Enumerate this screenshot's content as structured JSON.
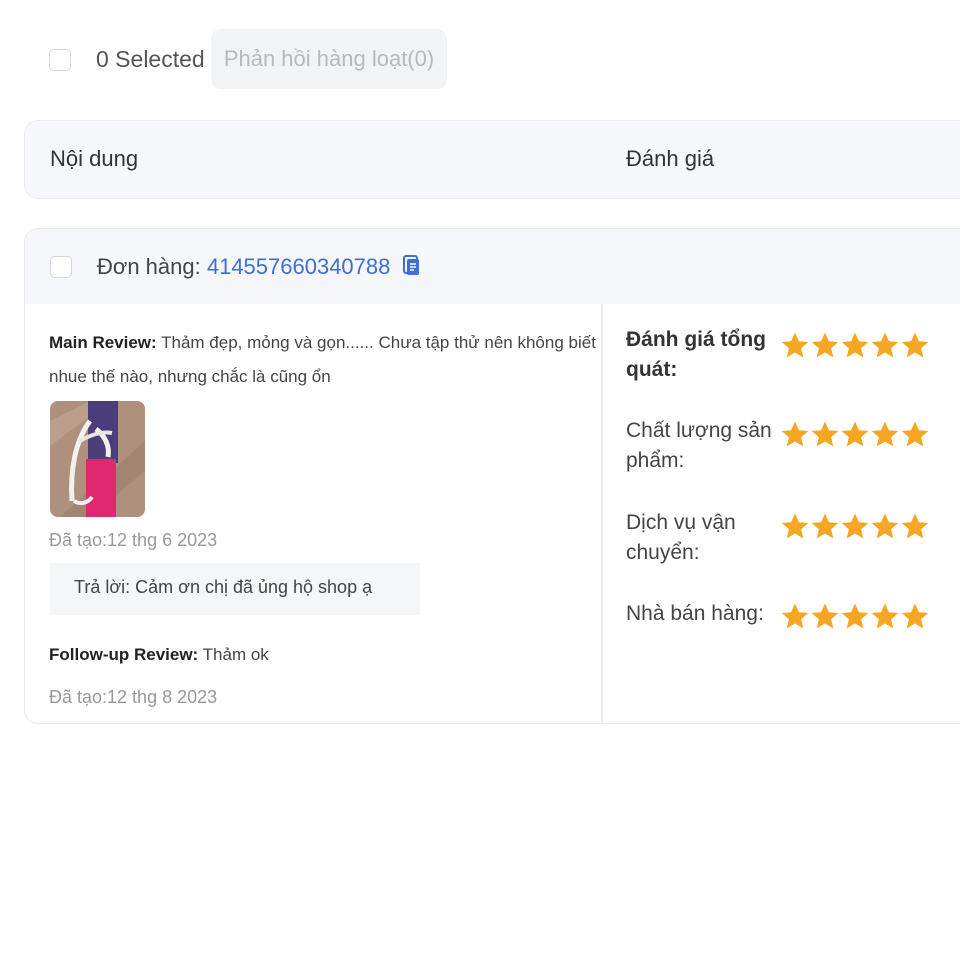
{
  "toolbar": {
    "selected_text": "0 Selected",
    "bulk_reply_label": "Phản hồi hàng loạt(0)"
  },
  "table_header": {
    "content_col": "Nội dung",
    "rating_col": "Đánh giá"
  },
  "review": {
    "order_label": "Đơn hàng:",
    "order_id": "414557660340788",
    "main_review_label": "Main Review:",
    "main_review_text_line1": "Thảm đẹp, mỏng và gọn...... Chưa tập thử nên không biết",
    "main_review_text_line2": "nhue thế nào, nhưng chắc là cũng ổn",
    "created_main": "Đã tạo:12 thg 6 2023",
    "reply": "Trả lời: Cảm ơn chị đã ủng hộ shop ạ",
    "followup_label": "Follow-up Review:",
    "followup_text": "Thảm ok",
    "created_followup": "Đã tạo:12 thg 8 2023"
  },
  "ratings": [
    {
      "label": "Đánh giá tổng quát:",
      "stars": 5
    },
    {
      "label": "Chất lượng sản phẩm:",
      "stars": 5
    },
    {
      "label": "Dịch vụ vận chuyển:",
      "stars": 5
    },
    {
      "label": "Nhà bán hàng:",
      "stars": 5
    }
  ],
  "colors": {
    "star": "#f5a623",
    "link": "#3f6ed6",
    "header_bg": "#f5f7fb"
  }
}
